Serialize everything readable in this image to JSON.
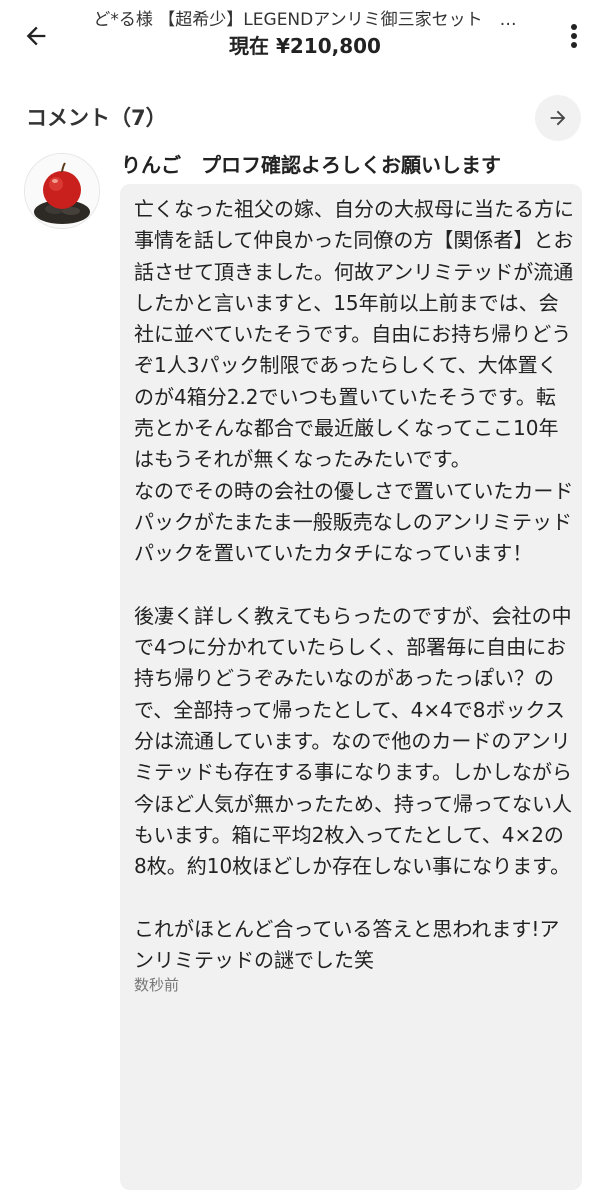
{
  "header": {
    "title": "ど*る様 【超希少】LEGENDアンリミ御三家セット　…",
    "price": "現在 ¥210,800"
  },
  "comments": {
    "title": "コメント（7）"
  },
  "comment": {
    "username": "りんご　プロフ確認よろしくお願いします",
    "text": "亡くなった祖父の嫁、自分の大叔母に当たる方に事情を話して仲良かった同僚の方【関係者】とお話させて頂きました。何故アンリミテッドが流通したかと言いますと、15年前以上前までは、会社に並べていたそうです。自由にお持ち帰りどうぞ1人3パック制限であったらしくて、大体置くのが4箱分2.2でいつも置いていたそうです。転売とかそんな都合で最近厳しくなってここ10年はもうそれが無くなったみたいです。\nなのでその時の会社の優しさで置いていたカードパックがたまたま一般販売なしのアンリミテッドパックを置いていたカタチになっています！\n\n後凄く詳しく教えてもらったのですが、会社の中で4つに分かれていたらしく、部署毎に自由にお持ち帰りどうぞみたいなのがあったっぽい？ので、全部持って帰ったとして、4×4で8ボックス分は流通しています。なので他のカードのアンリミテッドも存在する事になります。しかしながら今ほど人気が無かったため、持って帰ってない人もいます。箱に平均2枚入ってたとして、4×2の8枚。約10枚ほどしか存在しない事になります。\n\nこれがほとんど合っている答えと思われます!アンリミテッドの謎でした笑",
    "timestamp": "数秒前"
  },
  "icons": {
    "back": "arrow-left-icon",
    "more": "more-vertical-icon",
    "next": "arrow-right-icon",
    "avatar": "apple-avatar"
  },
  "colors": {
    "bubble": "#f1f1f1",
    "text": "#222222",
    "subtext": "#777777"
  }
}
